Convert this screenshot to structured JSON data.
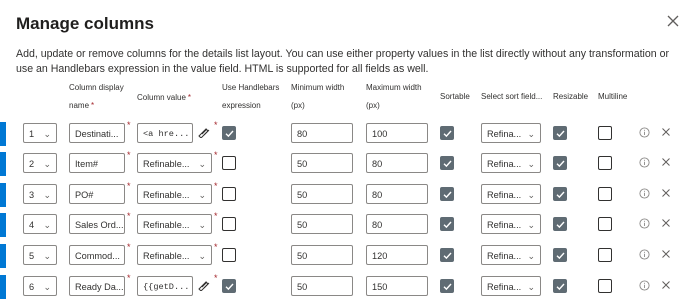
{
  "dialog": {
    "title": "Manage columns",
    "description": "Add, update or remove columns for the details list layout. You can use either property values in the list directly without any transformation or use an Handlebars expression in the value field. HTML is supported for all fields as well."
  },
  "headers": {
    "col_name_1": "Column display",
    "col_name_2": "name",
    "col_value": "Column value",
    "handlebars_1": "Use Handlebars",
    "handlebars_2": "expression",
    "min_1": "Minimum width",
    "min_2": "(px)",
    "max_1": "Maximum width",
    "max_2": "(px)",
    "sortable": "Sortable",
    "sort_field": "Select sort field...",
    "resizable": "Resizable",
    "multiline": "Multiline",
    "required_mark": "*"
  },
  "rows": [
    {
      "order": "1",
      "name": "Destinati...",
      "value": "<a hre...",
      "value_is_code": true,
      "handlebars": true,
      "min": "80",
      "max": "100",
      "sortable": true,
      "sort_field": "Refina...",
      "resizable": true,
      "multiline": false
    },
    {
      "order": "2",
      "name": "Item#",
      "value": "Refinable...",
      "value_is_code": false,
      "handlebars": false,
      "min": "50",
      "max": "80",
      "sortable": true,
      "sort_field": "Refina...",
      "resizable": true,
      "multiline": false
    },
    {
      "order": "3",
      "name": "PO#",
      "value": "Refinable...",
      "value_is_code": false,
      "handlebars": false,
      "min": "50",
      "max": "80",
      "sortable": true,
      "sort_field": "Refina...",
      "resizable": true,
      "multiline": false
    },
    {
      "order": "4",
      "name": "Sales Ord...",
      "value": "Refinable...",
      "value_is_code": false,
      "handlebars": false,
      "min": "50",
      "max": "80",
      "sortable": true,
      "sort_field": "Refina...",
      "resizable": true,
      "multiline": false
    },
    {
      "order": "5",
      "name": "Commod...",
      "value": "Refinable...",
      "value_is_code": false,
      "handlebars": false,
      "min": "50",
      "max": "120",
      "sortable": true,
      "sort_field": "Refina...",
      "resizable": true,
      "multiline": false
    },
    {
      "order": "6",
      "name": "Ready Da...",
      "value": "{{getD...",
      "value_is_code": true,
      "handlebars": true,
      "min": "50",
      "max": "150",
      "sortable": true,
      "sort_field": "Refina...",
      "resizable": true,
      "multiline": false
    }
  ],
  "icons": {
    "close": "close-icon",
    "edit": "edit-pencil-icon",
    "info": "info-icon",
    "delete": "delete-x-icon",
    "check": "checkmark-icon",
    "chevron": "chevron-down-icon"
  },
  "colors": {
    "checked": "#5f6b73",
    "required": "#a4262c",
    "accent": "#0078d4"
  }
}
